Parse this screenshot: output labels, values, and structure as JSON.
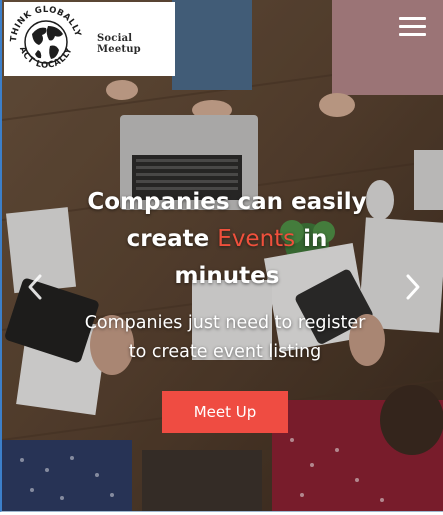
{
  "header": {
    "brand_name": "Social Meetup",
    "logo_ring_top": "THINK GLOBALLY",
    "logo_ring_bottom": "ACT LOCALLY",
    "menu_icon": "hamburger-menu-icon"
  },
  "hero": {
    "headline_line1": "Companies can easily",
    "headline_pre": "create ",
    "headline_accent": "Events",
    "headline_post": " in",
    "headline_line3": "minutes",
    "subtext_line1": "Companies just need to register",
    "subtext_line2": "to create event listing",
    "cta_label": "Meet Up",
    "prev_icon": "chevron-left-icon",
    "next_icon": "chevron-right-icon"
  },
  "colors": {
    "accent": "#ef4c42",
    "headline_accent": "#f0503c",
    "text": "#ffffff",
    "frame_border": "#3c7fc9"
  }
}
